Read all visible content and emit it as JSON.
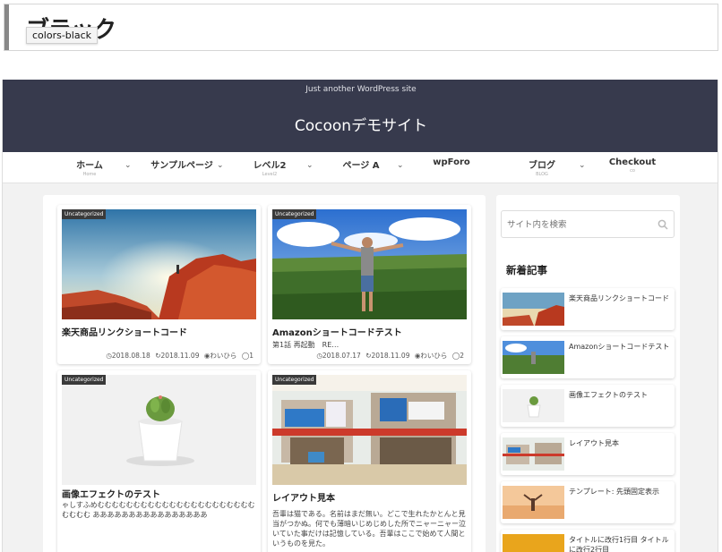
{
  "top": {
    "title": "ブラック",
    "tooltip": "colors-black"
  },
  "header": {
    "tagline": "Just another WordPress site",
    "site_title": "Cocoonデモサイト"
  },
  "nav": {
    "items": [
      {
        "label": "ホーム",
        "sub": "Home",
        "dropdown": true
      },
      {
        "label": "サンプルページ",
        "sub": "",
        "dropdown": true
      },
      {
        "label": "レベル2",
        "sub": "Level2",
        "dropdown": true
      },
      {
        "label": "ページ A",
        "sub": "",
        "dropdown": true
      },
      {
        "label": "wpForo",
        "sub": "",
        "dropdown": false
      },
      {
        "label": "ブログ",
        "sub": "BLOG",
        "dropdown": true
      },
      {
        "label": "Checkout",
        "sub": "co",
        "dropdown": false
      }
    ]
  },
  "posts": [
    {
      "category": "Uncategorized",
      "title": "楽天商品リンクショートコード",
      "snippet": "",
      "date": "2018.08.18",
      "updated": "2018.11.09",
      "author": "わいひら",
      "comments": "1",
      "thumb_icon": "red-rock-canyon-image"
    },
    {
      "category": "Uncategorized",
      "title": "Amazonショートコードテスト",
      "snippet": "第1話 再起動　RE…",
      "date": "2018.07.17",
      "updated": "2018.11.09",
      "author": "わいひら",
      "comments": "2",
      "thumb_icon": "man-arms-open-image"
    },
    {
      "category": "Uncategorized",
      "title": "画像エフェクトのテスト",
      "snippet": "ゃしすふめむむむむむむむむむむむむむむむむむむむむむむむむむむ ああああああああああああああああ",
      "thumb_icon": "cactus-pot-image"
    },
    {
      "category": "Uncategorized",
      "title": "レイアウト見本",
      "snippet": "吾輩は猫である。名前はまだ無い。どこで生れたかとんと見当がつかぬ。何でも薄暗いじめじめした所でニャーニャー泣いていた事だけは記憶している。吾輩はここで始めて人間というものを見た。",
      "thumb_icon": "street-shops-image"
    }
  ],
  "sidebar": {
    "search_placeholder": "サイト内を検索",
    "recent_heading": "新着記事",
    "recent": [
      {
        "label": "楽天商品リンクショートコード",
        "thumb_icon": "red-rock-canyon-image"
      },
      {
        "label": "Amazonショートコードテスト",
        "thumb_icon": "man-arms-open-image"
      },
      {
        "label": "画像エフェクトのテスト",
        "thumb_icon": "cactus-pot-image"
      },
      {
        "label": "レイアウト見本",
        "thumb_icon": "street-shops-image"
      },
      {
        "label": "テンプレート: 先頭固定表示",
        "thumb_icon": "beach-sunset-image"
      },
      {
        "label": "タイトルに改行1行目 タイトルに改行2行目",
        "thumb_icon": "yellow-abstract-image"
      }
    ]
  },
  "colors": {
    "header_bg": "#373a4d",
    "category_bg": "#3a3a3a",
    "page_bg": "#f2f2f2"
  }
}
